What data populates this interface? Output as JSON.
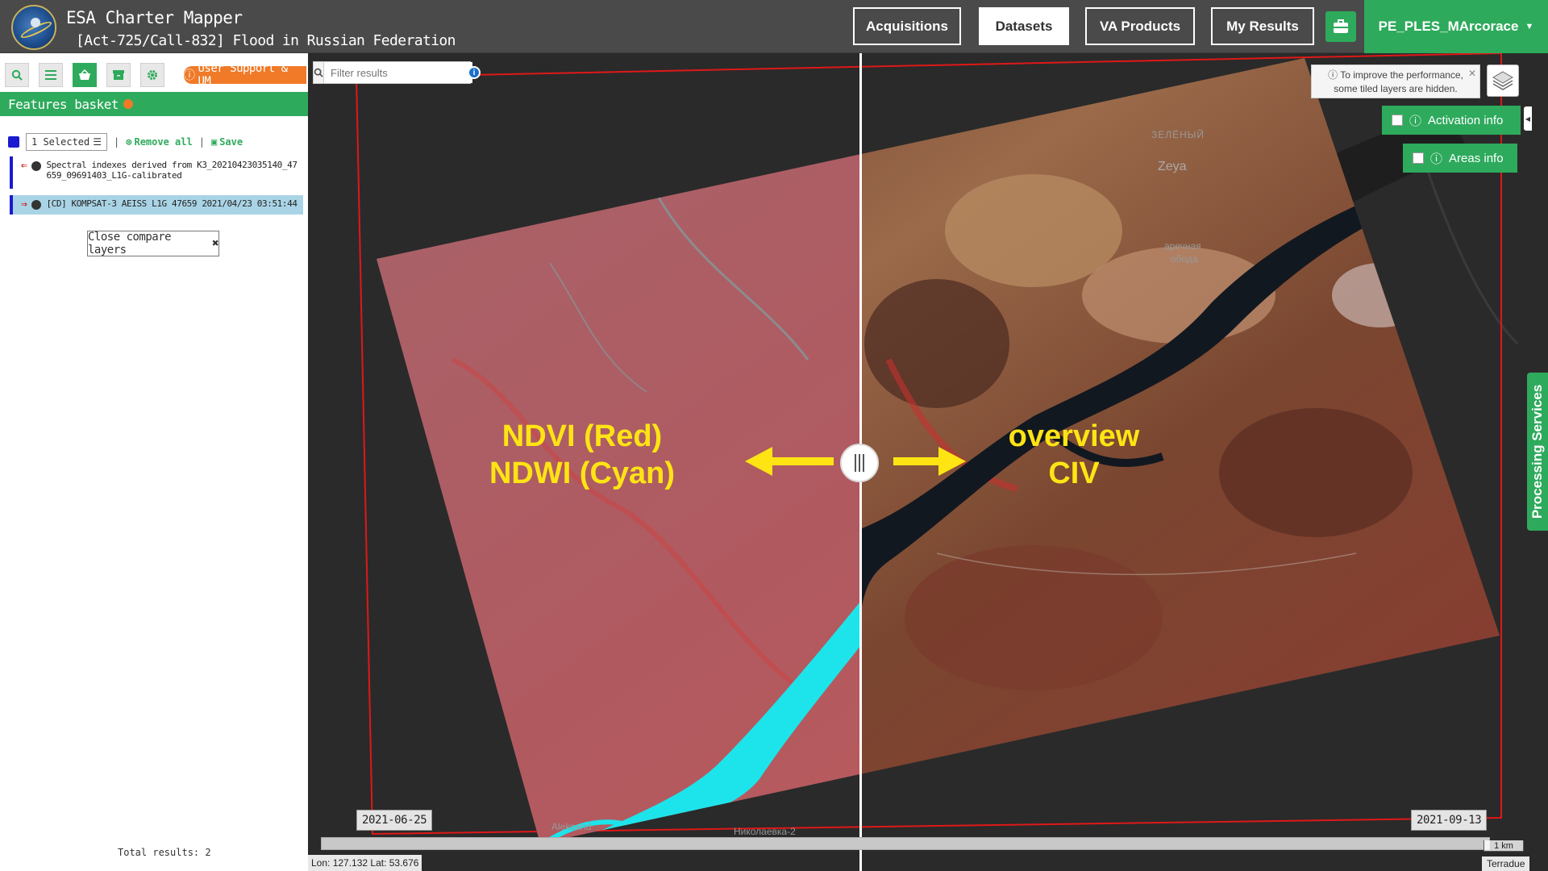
{
  "header": {
    "app_title": "ESA Charter Mapper",
    "subtitle": "[Act-725/Call-832] Flood in Russian Federation",
    "nav": [
      "Acquisitions",
      "Datasets",
      "VA Products",
      "My Results"
    ],
    "active_nav": "Datasets",
    "user": "PE_PLES_MArcorace"
  },
  "sidebar": {
    "support_label": "User Support & UM",
    "basket_title": "Features basket",
    "selected_label": "1 Selected",
    "remove_all": "Remove all",
    "save": "Save",
    "items": [
      {
        "text": "Spectral indexes derived from K3_20210423035140_47659_09691403_L1G-calibrated",
        "highlight": false
      },
      {
        "text": "[CD] KOMPSAT-3 AEISS L1G 47659 2021/04/23 03:51:44",
        "highlight": true
      }
    ],
    "close_compare": "Close compare layers",
    "total_results": "Total results: 2"
  },
  "map": {
    "filter_placeholder": "Filter results",
    "perf_note_line1": "To improve the performance,",
    "perf_note_line2": "some tiled layers are hidden.",
    "activation_info": "Activation info",
    "areas_info": "Areas info",
    "processing_services": "Processing Services",
    "overlay_left_line1": "NDVI (Red)",
    "overlay_left_line2": "NDWI (Cyan)",
    "overlay_right_line1": "overview",
    "overlay_right_line2": "CIV",
    "timeline_start": "2021-06-25",
    "timeline_end": "2021-09-13",
    "coords": "Lon: 127.132 Lat: 53.676",
    "scale": "1 km",
    "attribution": "Terradue",
    "places": {
      "zeya": "Zeya",
      "zeleny": "ЗЕЛЁНЫЙ",
      "zarechnaya1": "аречная",
      "zarechnaya2": "ободa",
      "aleksand": "Aleksand",
      "nikolaevka": "Николаевка-2"
    }
  },
  "colors": {
    "green": "#2eaa5c",
    "orange": "#f07a28",
    "header": "#4a4a4a",
    "overlay_text": "#ffe414",
    "ndwi_cyan": "#1de4ea"
  }
}
